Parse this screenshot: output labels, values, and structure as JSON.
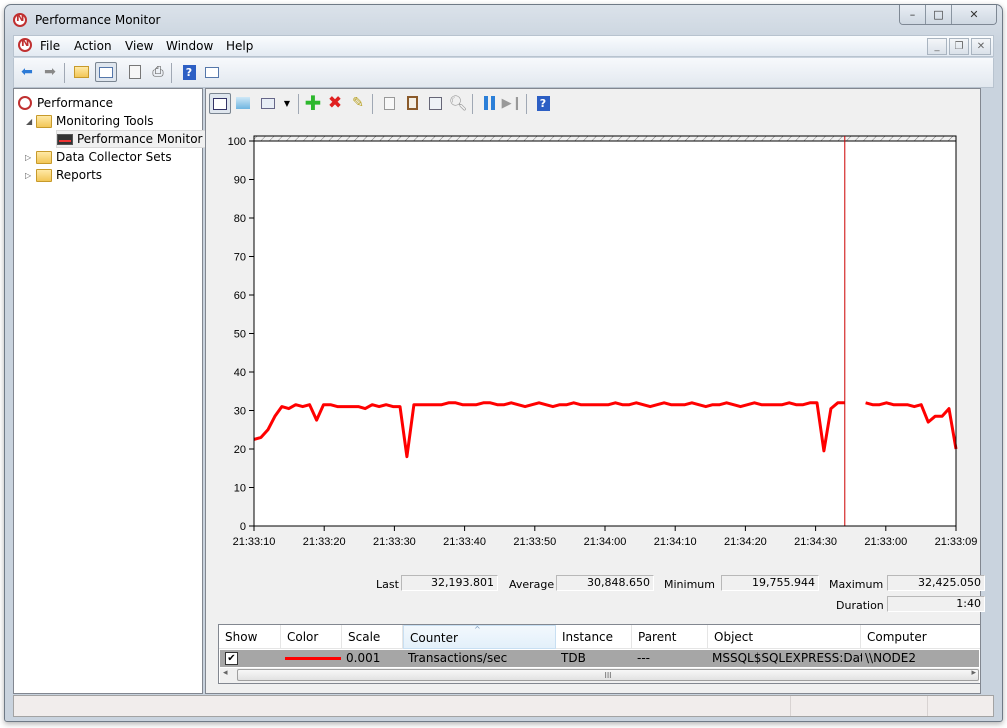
{
  "window": {
    "title": "Performance Monitor",
    "caption_buttons": {
      "minimize": "–",
      "maximize": "□",
      "close": "✕"
    },
    "mdi_buttons": {
      "minimize": "_",
      "restore": "❐",
      "close": "✕"
    }
  },
  "menu": {
    "items": [
      "File",
      "Action",
      "View",
      "Window",
      "Help"
    ]
  },
  "toolbar1": {
    "icons": [
      "back-icon",
      "forward-icon",
      "up-folder-icon",
      "show-hide-console-tree-icon",
      "properties-icon",
      "print-icon",
      "help-icon",
      "show-hide-action-pane-icon"
    ]
  },
  "tree": {
    "items": [
      {
        "label": "Performance",
        "level": 0,
        "icon": "performance-icon"
      },
      {
        "label": "Monitoring Tools",
        "level": 1,
        "icon": "folder-icon",
        "expanded": true
      },
      {
        "label": "Performance Monitor",
        "level": 2,
        "icon": "perfmon-graph-icon",
        "selected": true
      },
      {
        "label": "Data Collector Sets",
        "level": 1,
        "icon": "folder-icon",
        "expanded": false
      },
      {
        "label": "Reports",
        "level": 1,
        "icon": "folder-icon",
        "expanded": false
      }
    ]
  },
  "toolbar2": {
    "icons": [
      "view-current-activity-icon",
      "view-log-data-icon",
      "change-graph-type-icon",
      "dropdown-arrow-icon",
      "add-counter-icon",
      "delete-counter-icon",
      "highlight-icon",
      "copy-properties-icon",
      "paste-counter-list-icon",
      "properties-icon",
      "zoom-icon",
      "freeze-display-icon",
      "update-data-icon",
      "help-icon"
    ]
  },
  "chart_data": {
    "type": "line",
    "title": "",
    "xlabel": "",
    "ylabel": "",
    "ylim": [
      0,
      100
    ],
    "yticks": [
      0,
      10,
      20,
      30,
      40,
      50,
      60,
      70,
      80,
      90,
      100
    ],
    "xtick_labels": [
      "21:33:10",
      "21:33:20",
      "21:33:30",
      "21:33:40",
      "21:33:50",
      "21:34:00",
      "21:34:10",
      "21:34:20",
      "21:34:30",
      "21:33:00",
      "21:33:09"
    ],
    "grid": false,
    "current_time_marker_index": 85,
    "series": [
      {
        "name": "Transactions/sec",
        "color": "#ff0000",
        "values": [
          22.5,
          23,
          25,
          28.5,
          31,
          30.5,
          31.5,
          31,
          31.5,
          27.5,
          31.5,
          31.5,
          31,
          31,
          31,
          31,
          30.5,
          31.5,
          31,
          31.5,
          31,
          31,
          18,
          31.5,
          31.5,
          31.5,
          31.5,
          31.5,
          32,
          32,
          31.5,
          31.5,
          31.5,
          32,
          32,
          31.5,
          31.5,
          32,
          31.5,
          31,
          31.5,
          32,
          31.5,
          31,
          31.5,
          31.5,
          32,
          31.5,
          31.5,
          31.5,
          31.5,
          31.5,
          32,
          31.5,
          31.5,
          32,
          31.5,
          31,
          31.5,
          32,
          31.5,
          31.5,
          31.5,
          32,
          31.5,
          31,
          31.5,
          31.5,
          32,
          31.5,
          31,
          31.5,
          32,
          31.5,
          31.5,
          31.5,
          31.5,
          32,
          31.5,
          31.5,
          32,
          32,
          19.5,
          30.5,
          32,
          32,
          null,
          null,
          32,
          31.5,
          31.5,
          32,
          31.5,
          31.5,
          31.5,
          31,
          31.5,
          27,
          28.5,
          28.5,
          30.5,
          20
        ]
      }
    ]
  },
  "stats": {
    "last_label": "Last",
    "last": "32,193.801",
    "average_label": "Average",
    "average": "30,848.650",
    "minimum_label": "Minimum",
    "minimum": "19,755.944",
    "maximum_label": "Maximum",
    "maximum": "32,425.050",
    "duration_label": "Duration",
    "duration": "1:40"
  },
  "legend_table": {
    "columns": [
      "Show",
      "Color",
      "Scale",
      "Counter",
      "Instance",
      "Parent",
      "Object",
      "Computer"
    ],
    "sorted_column": "Counter",
    "rows": [
      {
        "show": true,
        "color": "#ff0000",
        "scale": "0.001",
        "counter": "Transactions/sec",
        "instance": "TDB",
        "parent": "---",
        "object": "MSSQL$SQLEXPRESS:Dat...",
        "computer": "\\\\NODE2"
      }
    ],
    "scroll_grip": "III"
  }
}
